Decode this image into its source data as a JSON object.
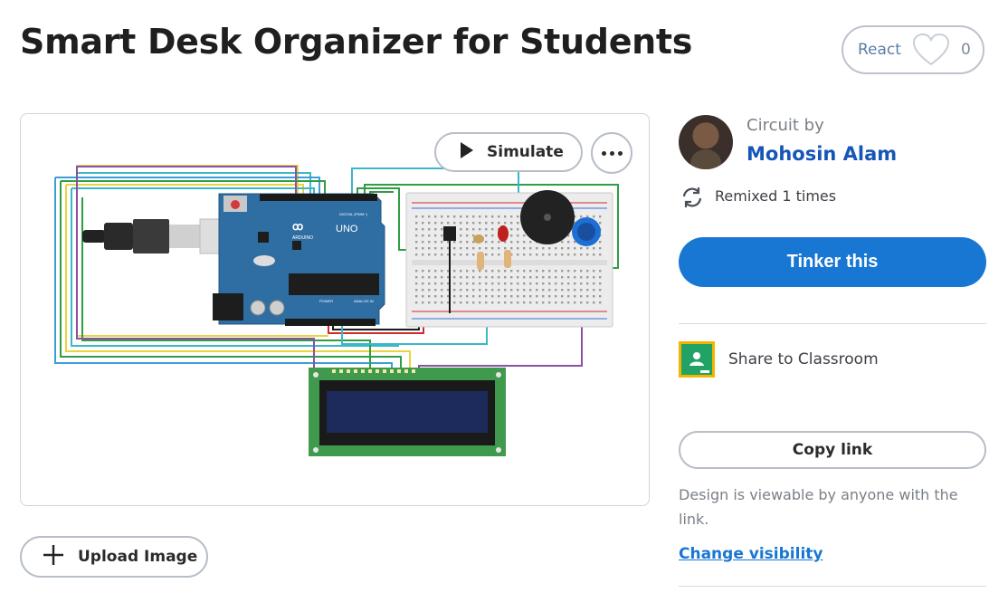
{
  "header": {
    "title": "Smart Desk Organizer for Students",
    "react_label": "React",
    "react_count": "0"
  },
  "canvas": {
    "simulate_label": "Simulate",
    "board_brand": "ARDUINO",
    "board_model": "UNO",
    "digital_label": "DIGITAL (PWM~)",
    "power_label": "POWER",
    "analog_label": "ANALOG IN"
  },
  "upload": {
    "label": "Upload Image"
  },
  "sidebar": {
    "circuit_by": "Circuit by",
    "author": "Mohosin Alam",
    "remix_text": "Remixed 1 times",
    "tinker_label": "Tinker this",
    "classroom_label": "Share to Classroom",
    "copy_label": "Copy link",
    "visibility_text": "Design is viewable by anyone with the link.",
    "visibility_link": "Change visibility"
  },
  "colors": {
    "accent": "#1877d2",
    "author": "#1656b8",
    "arduino": "#2f6ea3",
    "lcd_board": "#3f9a4e",
    "lcd_screen": "#1c2a5c"
  }
}
